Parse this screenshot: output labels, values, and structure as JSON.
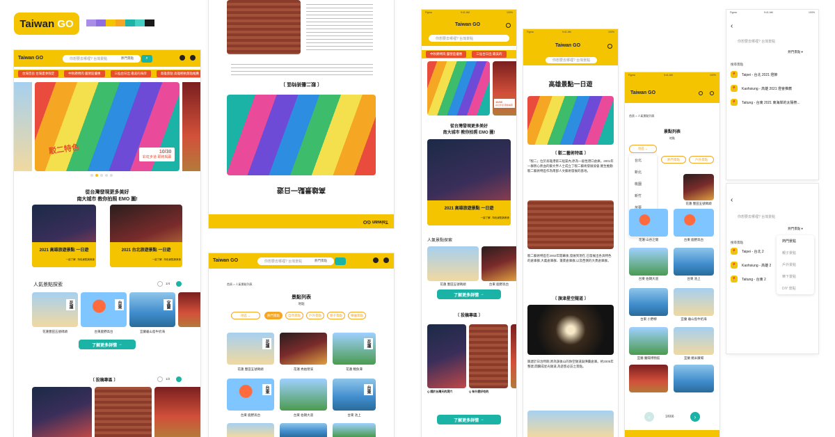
{
  "brand": {
    "logo_main": "Taiwan",
    "logo_go": "GO",
    "palette": [
      "#a98ee8",
      "#8f6fe0",
      "#f5c400",
      "#f5a623",
      "#1ab3a6",
      "#44d0c4",
      "#1a1a1a",
      "#f0f0f0"
    ]
  },
  "desktop": {
    "logo": "Taiwan GO",
    "search_placeholder": "你想要去哪裡? 台灣景點",
    "search_category": "熱門景點",
    "tickers": [
      "台灣百岳 台灣夏季限定",
      "中秋節烤肉 露營區優惠",
      "三仙台日出 最美的海岸",
      "高雄景點 高雄輕軌景點推薦"
    ],
    "hero_date": "10/30",
    "hero_caption": "彩虹步道 即將揭幕",
    "hero_text": "駁二特色",
    "intro_line1": "從台灣發現更多美好",
    "intro_line2": "南大城市 教你拍照 EMO 圖!",
    "feature_cards": [
      {
        "title": "2021 高雄旅遊景點 一日遊",
        "cta": "一起了解 , 特色景點與美食"
      },
      {
        "title": "2021 台北旅遊景點 一日遊",
        "cta": "一起了解 , 特色景點與美食"
      }
    ],
    "popular_title": "人氣景點探索",
    "popular_page": "1/4",
    "popular_items": [
      {
        "tag": "花蓮",
        "label": "花蓮豐田五號碼頭"
      },
      {
        "tag": "台東",
        "label": "台東鹿野高台"
      },
      {
        "tag": "宜蘭",
        "label": "宜蘭龜山島牛奶海"
      },
      {
        "tag": "",
        "label": ""
      }
    ],
    "more_button": "了解更多詳情",
    "submit_title": "〔 投稿專區 〕",
    "submit_page": "1/2"
  },
  "article_flipped": {
    "title": "高雄景點一日遊",
    "section": "〔 駁二藝術特區 〕",
    "logo": "Taiwan GO"
  },
  "list_desktop": {
    "logo": "Taiwan GO",
    "search_placeholder": "你想要去哪裡? 台灣景點",
    "search_category": "熱門景點",
    "breadcrumb": "首頁 > 人氣景點列表",
    "heading": "景點列表",
    "sub": "地點",
    "select": "地區",
    "chips": [
      "熱門景點",
      "自然景點",
      "戶外景點",
      "親子景點",
      "樂園景點"
    ],
    "cards": [
      {
        "tag": "花蓮",
        "label": "花蓮 豐田五號碼頭"
      },
      {
        "tag": "",
        "label": "花蓮 秀姑巒溪"
      },
      {
        "tag": "花蓮",
        "label": "花蓮 鯉魚潭"
      },
      {
        "tag": "台東",
        "label": "台東 鹿野高台"
      },
      {
        "tag": "",
        "label": "台東 伯朗大道"
      },
      {
        "tag": "台東",
        "label": "台東 池上"
      }
    ]
  },
  "mobile_home": {
    "status_carrier": "Figma",
    "status_time": "9:41 AM",
    "status_battery": "100%",
    "logo": "Taiwan GO",
    "search_placeholder": "你想要去哪裡? 台灣景點",
    "tickers": [
      "中秋節烤肉 露營區優惠",
      "三仙台日出 最美的"
    ],
    "hero_date": "10/30",
    "hero_caption": "彩虹步道 即將揭幕",
    "intro_line1": "從台灣發現更多美好",
    "intro_line2": "南大城市 教你拍照 EMO 圖!",
    "feature_title": "2021 高雄旅遊景點 一日遊",
    "feature_cta": "一起了解 , 特色景點與美食",
    "popular_title": "人氣景點探索",
    "popular_labels": [
      "花蓮 豐田五號碼頭",
      "台東 鹿野高台"
    ],
    "more_button": "了解更多詳情",
    "submit_title": "〔 投稿專區 〕",
    "submit_captions": [
      "Q 隱於台灣天的洞穴",
      "Q 有什麼好吃的"
    ],
    "more_button2": "了解更多詳情"
  },
  "mobile_article": {
    "status_carrier": "Figma",
    "status_time": "9:41 AM",
    "status_battery": "100%",
    "logo": "Taiwan GO",
    "search_placeholder": "你想要去哪裡? 台灣景點",
    "title": "高雄景點一日遊",
    "section1": "〔 駁二藝術特區 〕",
    "body1": "「駁二」位於高雄港第三船渠內,原為一般性港口倉庫。2001年一群熱心熱血的藝文界人士成立了駁二藝術發展協會,催生推動駁二藝術特區作為南部人文藝術發展的基地。",
    "body2": "駁二藝術特區在2002年開幕後,發展到現在,已發展出各具特色的倉庫群,大義倉庫群、蓬萊倉庫群,以及西側的大勇倉庫群。",
    "section2": "〔 旗津星空隧道 〕",
    "body3": "興建於日治時期,原為旗後山的防空隧道與彈藥倉庫。約2005年整建,開闢成星光隧道,為遊客必訪之景點。"
  },
  "mobile_list": {
    "status_carrier": "Figma",
    "status_time": "9:41 AM",
    "status_battery": "100%",
    "logo": "Taiwan GO",
    "breadcrumb": "首頁 > 人氣景點列表",
    "heading": "景點列表",
    "sub": "地點",
    "select": "地區",
    "dropdown": [
      "台北",
      "新北",
      "桃園",
      "新竹",
      "苗栗",
      "台中",
      "南投"
    ],
    "chips": [
      "熱門景點",
      "戶外景點"
    ],
    "cards": [
      {
        "label": "花蓮 豐田五號碼頭"
      },
      {
        "label": "花蓮 山谷之間"
      },
      {
        "label": "台東 鹿野高台"
      },
      {
        "label": "台東 伯朗大道"
      },
      {
        "label": "台東 池上"
      },
      {
        "label": "台東 小野柳"
      },
      {
        "label": "宜蘭 龜山島牛奶海"
      },
      {
        "label": "宜蘭 蘭陽博物館"
      },
      {
        "label": "宜蘭 幾米廣場"
      }
    ],
    "pagination": "1/666"
  },
  "search_a": {
    "status_carrier": "Figma",
    "status_time": "9:41 AM",
    "status_battery": "100%",
    "search_placeholder": "你想要去哪裡? 台灣景點",
    "category": "熱門景點",
    "result_title": "搜尋景點",
    "results": [
      "Taipei - 台北 2021 燈節",
      "Kaohsiung - 高雄 2021 燈會推薦",
      "Taitung - 台東 2021 東海岸的太陽祭..."
    ]
  },
  "search_b": {
    "search_placeholder": "你想要去哪裡? 台灣景點",
    "category": "熱門景點",
    "result_title": "搜尋景點",
    "results": [
      "Taipei - 台北 2",
      "Kaohsiung - 高雄 2",
      "Taitung - 台東 2"
    ],
    "options": [
      "熱門景點",
      "親子景點",
      "戶外景點",
      "樂下景點",
      "DIY 景點"
    ]
  }
}
